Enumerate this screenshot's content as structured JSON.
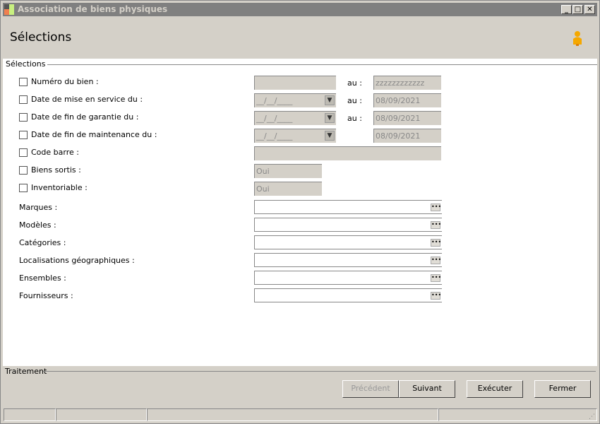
{
  "window": {
    "title": "Association de biens physiques",
    "min": "_",
    "max": "□",
    "close": "✕"
  },
  "header": {
    "title": "Sélections"
  },
  "selections": {
    "legend": "Sélections",
    "au_label": "au :",
    "rows": [
      {
        "label": "Numéro du bien :",
        "from": "",
        "to": "zzzzzzzzzzzz"
      },
      {
        "label": "Date de mise en service du :",
        "from": "__/__/____",
        "to": "08/09/2021"
      },
      {
        "label": "Date de fin de garantie du :",
        "from": "__/__/____",
        "to": "08/09/2021"
      },
      {
        "label": "Date de fin de maintenance du :",
        "from": "__/__/____",
        "to": "08/09/2021"
      },
      {
        "label": "Code barre :",
        "value": ""
      },
      {
        "label": "Biens sortis :",
        "value": "Oui"
      },
      {
        "label": "Inventoriable :",
        "value": "Oui"
      }
    ],
    "lookups": [
      {
        "label": "Marques :",
        "value": ""
      },
      {
        "label": "Modèles :",
        "value": ""
      },
      {
        "label": "Catégories :",
        "value": ""
      },
      {
        "label": "Localisations géographiques :",
        "value": ""
      },
      {
        "label": "Ensembles :",
        "value": ""
      },
      {
        "label": "Fournisseurs :",
        "value": ""
      }
    ],
    "browse": "•••"
  },
  "traitement": {
    "legend": "Traitement",
    "buttons": {
      "prev": "Précédent",
      "next": "Suivant",
      "run": "Exécuter",
      "close": "Fermer"
    }
  }
}
